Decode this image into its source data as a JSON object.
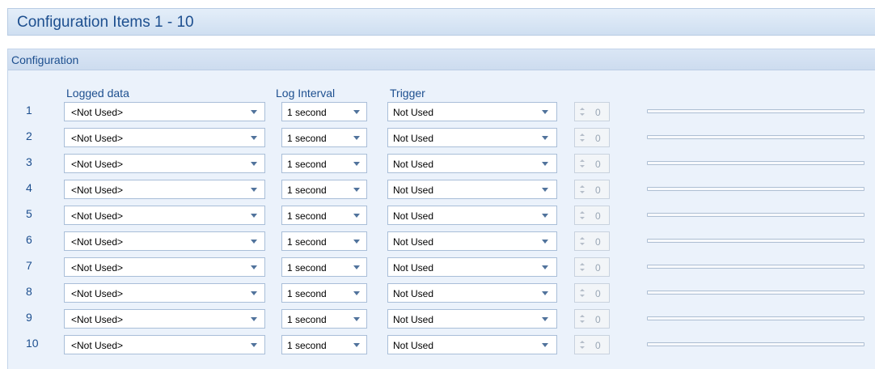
{
  "title": "Configuration Items 1 - 10",
  "section_title": "Configuration",
  "columns": {
    "logged_data": "Logged data",
    "log_interval": "Log Interval",
    "trigger": "Trigger"
  },
  "rows": [
    {
      "num": "1",
      "logged_data": "<Not Used>",
      "interval": "1 second",
      "trigger": "Not Used",
      "value": "0",
      "progress": 0
    },
    {
      "num": "2",
      "logged_data": "<Not Used>",
      "interval": "1 second",
      "trigger": "Not Used",
      "value": "0",
      "progress": 0
    },
    {
      "num": "3",
      "logged_data": "<Not Used>",
      "interval": "1 second",
      "trigger": "Not Used",
      "value": "0",
      "progress": 0
    },
    {
      "num": "4",
      "logged_data": "<Not Used>",
      "interval": "1 second",
      "trigger": "Not Used",
      "value": "0",
      "progress": 0
    },
    {
      "num": "5",
      "logged_data": "<Not Used>",
      "interval": "1 second",
      "trigger": "Not Used",
      "value": "0",
      "progress": 0
    },
    {
      "num": "6",
      "logged_data": "<Not Used>",
      "interval": "1 second",
      "trigger": "Not Used",
      "value": "0",
      "progress": 0
    },
    {
      "num": "7",
      "logged_data": "<Not Used>",
      "interval": "1 second",
      "trigger": "Not Used",
      "value": "0",
      "progress": 0
    },
    {
      "num": "8",
      "logged_data": "<Not Used>",
      "interval": "1 second",
      "trigger": "Not Used",
      "value": "0",
      "progress": 0
    },
    {
      "num": "9",
      "logged_data": "<Not Used>",
      "interval": "1 second",
      "trigger": "Not Used",
      "value": "0",
      "progress": 0
    },
    {
      "num": "10",
      "logged_data": "<Not Used>",
      "interval": "1 second",
      "trigger": "Not Used",
      "value": "0",
      "progress": 0
    }
  ],
  "icons": {
    "dropdown": "chevron-down-icon",
    "spinner_up": "spin-up-icon",
    "spinner_down": "spin-down-icon"
  },
  "colors": {
    "accent_text": "#1d4f8f",
    "panel_background": "#ebf2fb"
  }
}
